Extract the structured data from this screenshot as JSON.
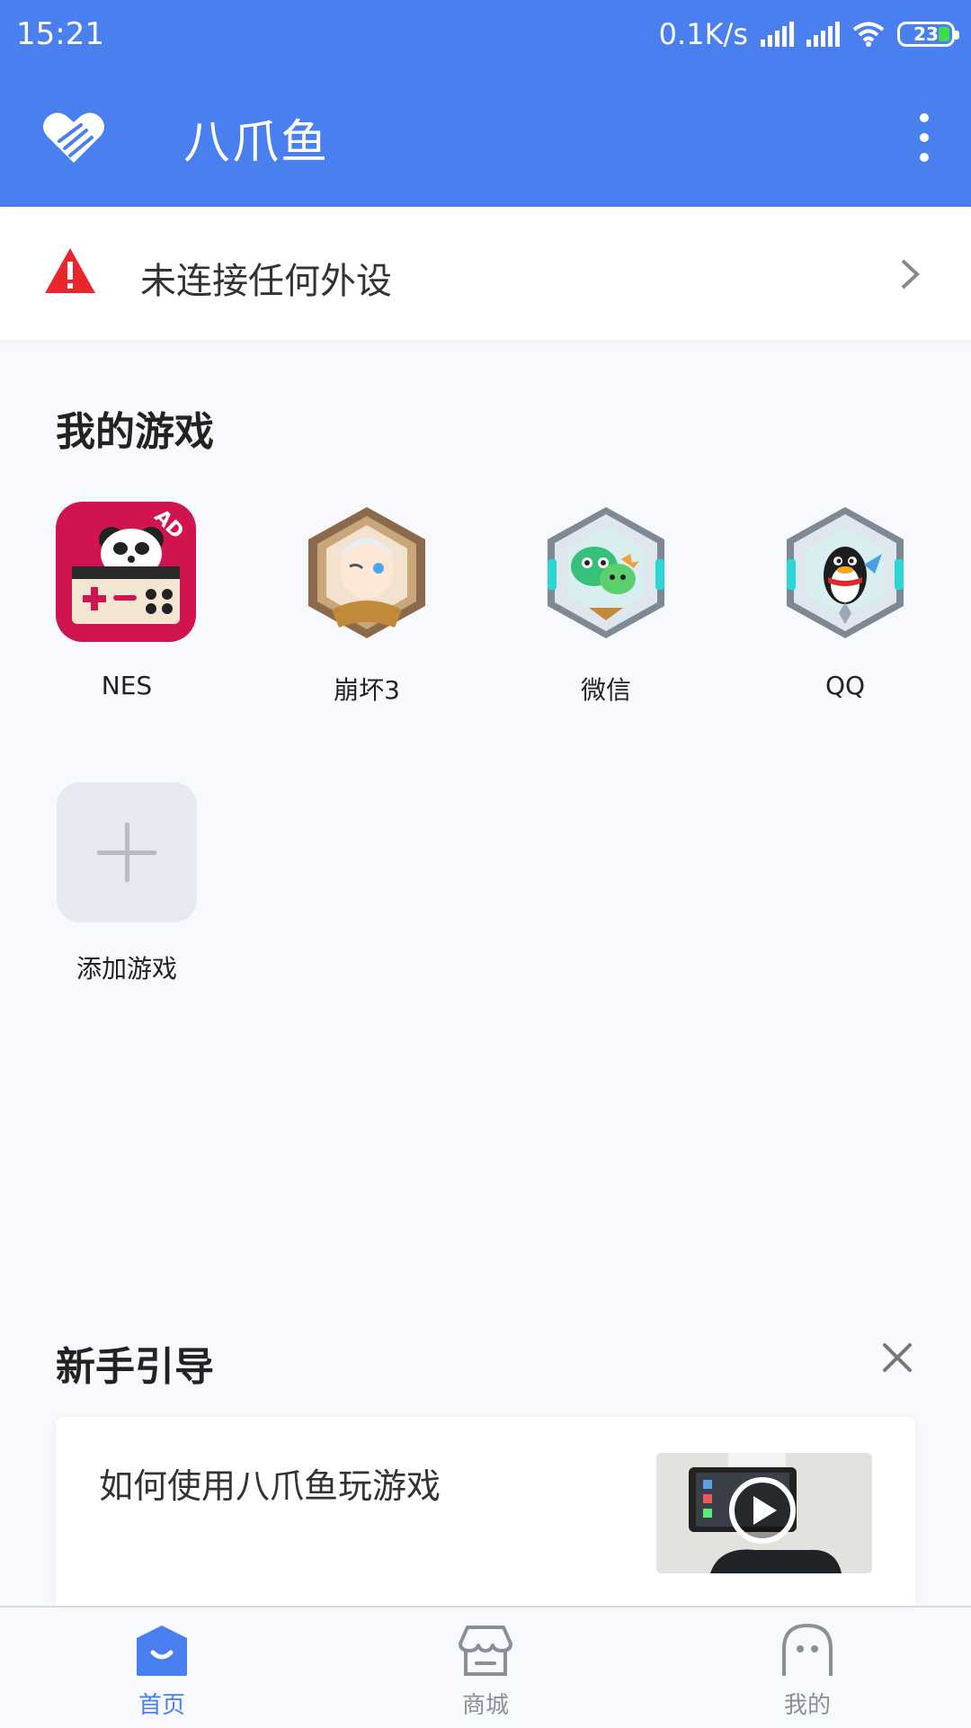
{
  "status_bar": {
    "time": "15:21",
    "net_speed": "0.1K/s",
    "battery": "23"
  },
  "app_bar": {
    "title": "八爪鱼",
    "logo_icon": "heart-hand-logo",
    "menu_icon": "more-vertical-icon"
  },
  "alert": {
    "icon": "warning-icon",
    "text": "未连接任何外设",
    "color": "#e8262c"
  },
  "my_games": {
    "title": "我的游戏",
    "games": [
      {
        "label": "NES",
        "badge": "AD"
      },
      {
        "label": "崩坏3"
      },
      {
        "label": "微信"
      },
      {
        "label": "QQ"
      }
    ],
    "add_label": "添加游戏"
  },
  "guide": {
    "title": "新手引导",
    "card_text": "如何使用八爪鱼玩游戏"
  },
  "bottom_nav": {
    "items": [
      {
        "label": "首页",
        "active": true
      },
      {
        "label": "商城",
        "active": false
      },
      {
        "label": "我的",
        "active": false
      }
    ]
  },
  "colors": {
    "brand": "#4a7ff0",
    "background": "#f7f9fc",
    "nes": "#d0144f"
  }
}
